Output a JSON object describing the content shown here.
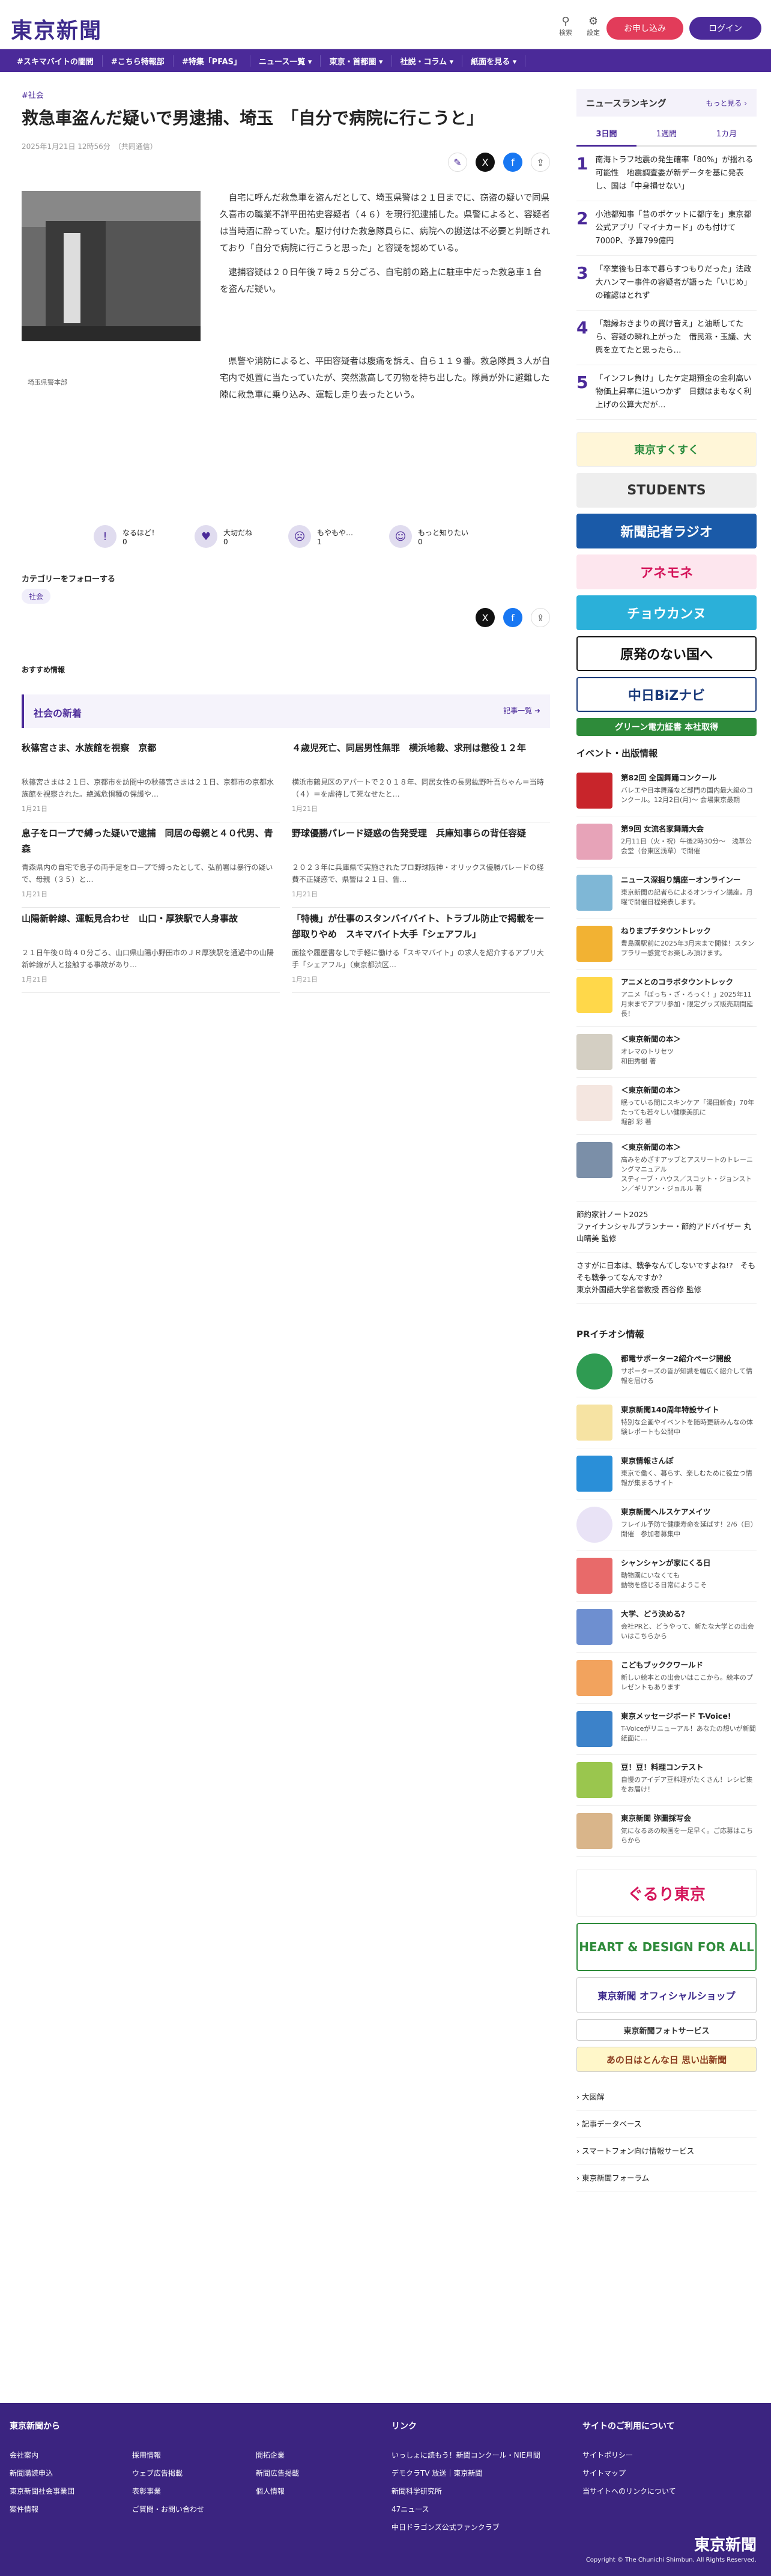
{
  "header": {
    "logo": "東京新聞",
    "search": "検索",
    "settings": "設定",
    "apply": "お申し込み",
    "login": "ログイン"
  },
  "nav": [
    "#スキマバイトの闇間",
    "#こちら特報部",
    "#特集「PFAS」",
    "ニュース一覧 ▾",
    "東京・首都圏 ▾",
    "社説・コラム ▾",
    "紙面を見る ▾"
  ],
  "article": {
    "category": "#社会",
    "title": "救急車盗んだ疑いで男逮捕、埼玉　「自分で病院に行こうと」",
    "date": "2025年1月21日 12時56分　（共同通信）",
    "caption": "埼玉県警本部",
    "p1": "自宅に呼んだ救急車を盗んだとして、埼玉県警は２１日までに、窃盗の疑いで同県久喜市の職業不詳平田祐史容疑者（４６）を現行犯逮捕した。県警によると、容疑者は当時酒に酔っていた。駆け付けた救急隊員らに、病院への搬送は不必要と判断されており「自分で病院に行こうと思った」と容疑を認めている。",
    "p2": "逮捕容疑は２０日午後７時２５分ごろ、自宅前の路上に駐車中だった救急車１台を盗んだ疑い。",
    "p3": "県警や消防によると、平田容疑者は腹痛を訴え、自ら１１９番。救急隊員３人が自宅内で処置に当たっていたが、突然激高して刃物を持ち出した。隊員が外に避難した隙に救急車に乗り込み、運転し走り去ったという。",
    "reactions": [
      {
        "label": "なるほど！",
        "count": "0"
      },
      {
        "label": "大切だね",
        "count": "0"
      },
      {
        "label": "もやもや…",
        "count": "1"
      },
      {
        "label": "もっと知りたい",
        "count": "0"
      }
    ],
    "follow": "カテゴリーをフォローする",
    "tag": "社会",
    "recommend": "おすすめ情報"
  },
  "news": {
    "heading": "社会の新着",
    "more": "記事一覧 ➜",
    "items": [
      {
        "h": "秋篠宮さま、水族館を視察　京都",
        "s": "秋篠宮さまは２１日、京都市を訪問中の秋篠宮さまは２１日、京都市の京都水族館を視察された。絶滅危惧種の保護や…",
        "d": "1月21日"
      },
      {
        "h": "４歳児死亡、同居男性無罪　横浜地裁、求刑は懲役１２年",
        "s": "横浜市鶴見区のアパートで２０１８年、同居女性の長男紘野叶吾ちゃん＝当時（４）＝を虐待して死なせたと…",
        "d": "1月21日"
      },
      {
        "h": "息子をロープで縛った疑いで逮捕　同居の母親と４０代男、青森",
        "s": "青森県内の自宅で息子の両手足をロープで縛ったとして、弘前署は暴行の疑いで、母親（３５）と…",
        "d": "1月21日"
      },
      {
        "h": "野球優勝パレード疑惑の告発受理　兵庫知事らの背任容疑",
        "s": "２０２３年に兵庫県で実施されたプロ野球阪神・オリックス優勝パレードの経費不正疑惑で、県警は２１日、告…",
        "d": "1月21日"
      },
      {
        "h": "山陽新幹線、運転見合わせ　山口・厚狭駅で人身事故",
        "s": "２１日午後０時４０分ごろ、山口県山陽小野田市のＪＲ厚狭駅を通過中の山陽新幹線が人と接触する事故があり…",
        "d": "1月21日"
      },
      {
        "h": "「特機」が仕事のスタンバイバイト、トラブル防止で掲載を一部取りやめ　スキマバイト大手「シェアフル」",
        "s": "面接や履歴書なしで手軽に働ける「スキマバイト」の求人を紹介するアプリ大手「シェアフル」（東京都渋区…",
        "d": "1月21日"
      }
    ]
  },
  "ranking": {
    "title": "ニュースランキング",
    "more": "もっと見る ›",
    "tabs": [
      "3日間",
      "1週間",
      "1カ月"
    ],
    "items": [
      {
        "n": "1",
        "t": "南海トラフ地震の発生確率「80%」が揺れる可能性　地震調査委が新データを基に発表し、国は「中身損せない」"
      },
      {
        "n": "2",
        "t": "小池都知事「昔のポケットに都庁を」東京都公式アプリ「マイナカード」のも付けて7000P、予算799億円"
      },
      {
        "n": "3",
        "t": "「卒業後も日本で暮らすつもりだった」法政大ハンマー事件の容疑者が語った「いじめ」の確認はとれず"
      },
      {
        "n": "4",
        "t": "「離縁おきまりの買け音え」と油断してたら、容疑の瞬れ上がった　借民派・玉議、大興を立てたと思ったら…"
      },
      {
        "n": "5",
        "t": "「インフレ負け」したケ定期預金の金利高い物価上昇率に追いつかず　日銀はまもなく利上げの公算大だが…"
      }
    ]
  },
  "banners": [
    "東京すくすく",
    "STUDENTS",
    "新聞記者ラジオ",
    "アネモネ",
    "チョウカンヌ",
    "原発のない国へ",
    "中日BiZナビ",
    "グリーン電力証書 本社取得"
  ],
  "events": {
    "title": "イベント・出版情報",
    "items": [
      {
        "t": "第82回 全国舞踊コンクール",
        "s": "バレエや日本舞踊など部門の国内最大級のコンクール。12月2日(月)～ 会場東京最期"
      },
      {
        "t": "第9回 女流名家舞踊大会",
        "s": "2月11日（火・祝）午後2時30分～　浅草公会堂（台東区浅草）で開催"
      },
      {
        "t": "ニュース深掘り講座ーオンラインー",
        "s": "東京新聞の記者らによるオンライン講座。月曜で開催日程発表します。"
      },
      {
        "t": "ねりまプチタウントレック",
        "s": "豊島園駅前に2025年3月末まで開催！スタンプラリー感覚でお楽しみ頂けます。"
      },
      {
        "t": "アニメとのコラボタウントレック",
        "s": "アニメ「ぼっち・ざ・ろっく！」2025年11月末までアプリ参加・限定グッズ販売期間延長！"
      },
      {
        "t": "＜東京新聞の本＞",
        "s": "オレマのトリセツ\n和田秀樹 著"
      },
      {
        "t": "＜東京新聞の本＞",
        "s": "眠っている間にスキンケア「湯田新食」70年たっても若々しい健康美肌に\n堀部 彩 著"
      },
      {
        "t": "＜東京新聞の本＞",
        "s": "高みをめざすアップとアスリートのトレーニングマニュアル\nスティーブ・ハウス／スコット・ジョンストン／ギリアン・ジョルル 著"
      }
    ],
    "links": [
      "節約家計ノート2025\nファイナンシャルプランナー・節約アドバイザー 丸山晴美 監修",
      "さすがに日本は、戦争なんてしないですよね!?　そもそも戦争ってなんですか？\n東京外国語大学名誉教授 西谷修 監修"
    ]
  },
  "pr": {
    "title": "PRイチオシ情報",
    "items": [
      {
        "t": "都電サポーター2紹介ページ開設",
        "s": "サポーターズの皆が知識を幅広く紹介して情報を届ける"
      },
      {
        "t": "東京新聞140周年特設サイト",
        "s": "特別な企画やイベントを随時更新みんなの体験レポートも公開中"
      },
      {
        "t": "東京情報さんぽ",
        "s": "東京で働く、暮らす、楽しむために役立つ情報が集まるサイト"
      },
      {
        "t": "東京新聞ヘルスケアメイツ",
        "s": "フレイル予防で健康寿命を延ばす！2/6（日）開催　参加者募集中"
      },
      {
        "t": "シャンシャンが家にくる日",
        "s": "動物園にいなくても\n動物を感じる日常にようこそ"
      },
      {
        "t": "大学、どう決める？",
        "s": "会社PRと、どうやって、新たな大学との出会いはこちらから"
      },
      {
        "t": "こどもブッククワールド",
        "s": "新しい絵本との出会いはここから。絵本のプレゼントもあります"
      },
      {
        "t": "東京メッセージボード T-Voice!",
        "s": "T-Voiceがリニューアル！あなたの想いが新聞紙面に…"
      },
      {
        "t": "豆！豆！料理コンテスト",
        "s": "自慢のアイデア豆料理がたくさん！レシピ集をお届け！"
      },
      {
        "t": "東京新聞 弥圖採写会",
        "s": "気になるあの映画を一足早く。ご応募はこちらから"
      }
    ]
  },
  "bottom_banners": [
    "ぐるり東京",
    "HEART & DESIGN FOR ALL",
    "東京新聞 オフィシャルショップ",
    "東京新聞フォトサービス",
    "あの日はとんな日 思い出新聞"
  ],
  "side_links": [
    "大図解",
    "記事データベース",
    "スマートフォン向け情報サービス",
    "東京新聞フォーラム"
  ],
  "footer": {
    "col1_title": "東京新聞から",
    "col1": [
      "会社案内",
      "新聞購読申込",
      "東京新聞社会事業団",
      "案件情報"
    ],
    "col1b": [
      "採用情報",
      "ウェブ広告掲載",
      "表彰事業",
      "ご質問・お問い合わせ"
    ],
    "col1c": [
      "開拓企業",
      "新聞広告掲載",
      "個人情報"
    ],
    "col2_title": "リンク",
    "col2": [
      "いっしょに読もう！新聞コンクール・NIE月間",
      "デモクラTV 放送｜東京新聞",
      "新聞科学研究所",
      "47ニュース",
      "中日ドラゴンズ公式ファンクラブ"
    ],
    "col3_title": "サイトのご利用について",
    "col3": [
      "サイトポリシー",
      "サイトマップ",
      "当サイトへのリンクについて"
    ],
    "logo": "東京新聞",
    "copyright": "Copyright © The Chunichi Shimbun, All Rights Reserved."
  }
}
